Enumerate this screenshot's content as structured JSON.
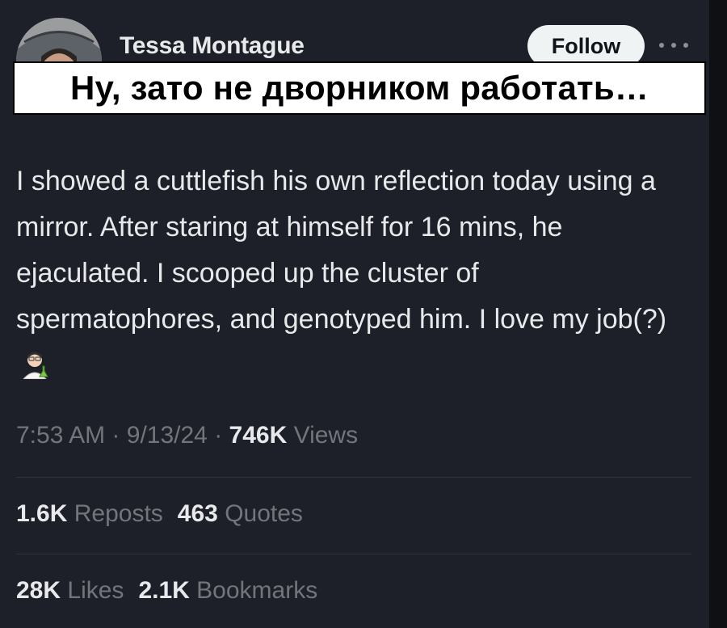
{
  "author": {
    "name": "Tessa Montague"
  },
  "header": {
    "follow_label": "Follow",
    "more_icon": "more-horizontal-icon"
  },
  "overlay": {
    "caption": "Ну, зато не дворником работать…"
  },
  "tweet": {
    "text": "I showed a cuttlefish his own reflection today using a mirror. After staring at himself for 16 mins, he ejaculated. I scooped up the cluster of spermatophores, and genotyped him. I love my job(?)",
    "emoji": "scientist-emoji"
  },
  "meta": {
    "time": "7:53 AM",
    "date": "9/13/24",
    "views_count": "746K",
    "views_label": "Views",
    "separator": "·"
  },
  "stats": {
    "reposts_count": "1.6K",
    "reposts_label": "Reposts",
    "quotes_count": "463",
    "quotes_label": "Quotes",
    "likes_count": "28K",
    "likes_label": "Likes",
    "bookmarks_count": "2.1K",
    "bookmarks_label": "Bookmarks"
  },
  "colors": {
    "background": "#1e2029",
    "text": "#e7e9ea",
    "muted": "#71767b",
    "follow_bg": "#eff3f4"
  }
}
